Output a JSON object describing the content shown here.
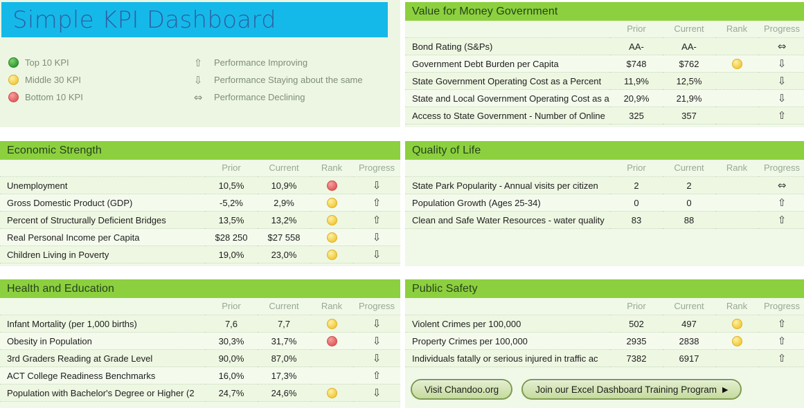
{
  "title": {
    "text": "Simple KPI Dashboard",
    "bar_color": "#15b9e9",
    "text_color": "#2e5fa3"
  },
  "legend": {
    "rank_items": [
      {
        "label": "Top 10 KPI",
        "color": "#2f9b34",
        "swatch": "green"
      },
      {
        "label": "Middle 30 KPI",
        "color": "#f2c832",
        "swatch": "yellow"
      },
      {
        "label": "Bottom 10 KPI",
        "color": "#e05858",
        "swatch": "red"
      }
    ],
    "progress_items": [
      {
        "glyph": "⇧",
        "icon": "arrow-up-icon",
        "label": "Performance Improving"
      },
      {
        "glyph": "⇩",
        "icon": "arrow-down-icon",
        "label": "Performance Staying about the same"
      },
      {
        "glyph": "⇔",
        "icon": "arrow-left-right-icon",
        "label": "Performance Declining"
      }
    ]
  },
  "columns": [
    "",
    "Prior",
    "Current",
    "Rank",
    "Progress"
  ],
  "panels": [
    {
      "id": "vmg",
      "title": "Value for Money Government",
      "rows": [
        {
          "name": "Bond Rating (S&Ps)",
          "prior": "AA-",
          "current": "AA-",
          "rank": "",
          "progress": "⇔"
        },
        {
          "name": "Government Debt Burden per Capita",
          "prior": "$748",
          "current": "$762",
          "rank": "yellow",
          "progress": "⇩"
        },
        {
          "name": "State Government Operating Cost as a Percent ",
          "prior": "11,9%",
          "current": "12,5%",
          "rank": "",
          "progress": "⇩"
        },
        {
          "name": "State and Local Government Operating Cost as a",
          "prior": "20,9%",
          "current": "21,9%",
          "rank": "",
          "progress": "⇩"
        },
        {
          "name": "Access to State Government - Number of Online",
          "prior": "325",
          "current": "357",
          "rank": "",
          "progress": "⇧"
        }
      ]
    },
    {
      "id": "econ",
      "title": "Economic Strength",
      "rows": [
        {
          "name": "Unemployment",
          "prior": "10,5%",
          "current": "10,9%",
          "rank": "red",
          "progress": "⇩"
        },
        {
          "name": "Gross Domestic Product (GDP)",
          "prior": "-5,2%",
          "current": "2,9%",
          "rank": "yellow",
          "progress": "⇧"
        },
        {
          "name": "Percent of Structurally Deficient Bridges",
          "prior": "13,5%",
          "current": "13,2%",
          "rank": "yellow",
          "progress": "⇧"
        },
        {
          "name": "Real Personal Income per Capita",
          "prior": "$28 250",
          "current": "$27 558",
          "rank": "yellow",
          "progress": "⇩"
        },
        {
          "name": "Children Living in Poverty",
          "prior": "19,0%",
          "current": "23,0%",
          "rank": "yellow",
          "progress": "⇩"
        }
      ]
    },
    {
      "id": "qol",
      "title": "Quality of Life",
      "rows": [
        {
          "name": "State Park Popularity - Annual visits per citizen",
          "prior": "2",
          "current": "2",
          "rank": "",
          "progress": "⇔"
        },
        {
          "name": "Population Growth (Ages 25-34)",
          "prior": "0",
          "current": "0",
          "rank": "",
          "progress": "⇧"
        },
        {
          "name": "Clean and Safe Water Resources - water quality",
          "prior": "83",
          "current": "88",
          "rank": "",
          "progress": "⇧"
        }
      ]
    },
    {
      "id": "heal",
      "title": "Health and Education",
      "rows": [
        {
          "name": "Infant Mortality (per 1,000 births)",
          "prior": "7,6",
          "current": "7,7",
          "rank": "yellow",
          "progress": "⇩"
        },
        {
          "name": "Obesity in Population",
          "prior": "30,3%",
          "current": "31,7%",
          "rank": "red",
          "progress": "⇩"
        },
        {
          "name": "3rd Graders Reading at Grade Level",
          "prior": "90,0%",
          "current": "87,0%",
          "rank": "",
          "progress": "⇩"
        },
        {
          "name": "ACT College Readiness Benchmarks",
          "prior": "16,0%",
          "current": "17,3%",
          "rank": "",
          "progress": "⇧"
        },
        {
          "name": "Population with Bachelor's Degree or Higher (2",
          "prior": "24,7%",
          "current": "24,6%",
          "rank": "yellow",
          "progress": "⇩"
        }
      ]
    },
    {
      "id": "psaf",
      "title": "Public Safety",
      "rows": [
        {
          "name": "Violent Crimes per 100,000",
          "prior": "502",
          "current": "497",
          "rank": "yellow",
          "progress": "⇧"
        },
        {
          "name": "Property Crimes per 100,000",
          "prior": "2935",
          "current": "2838",
          "rank": "yellow",
          "progress": "⇧"
        },
        {
          "name": "Individuals fatally or serious injured in traffic ac",
          "prior": "7382",
          "current": "6917",
          "rank": "",
          "progress": "⇧"
        }
      ]
    }
  ],
  "buttons": [
    {
      "label": "Visit Chandoo.org",
      "caret": ""
    },
    {
      "label": "Join our Excel Dashboard Training Program",
      "caret": "▶"
    }
  ]
}
